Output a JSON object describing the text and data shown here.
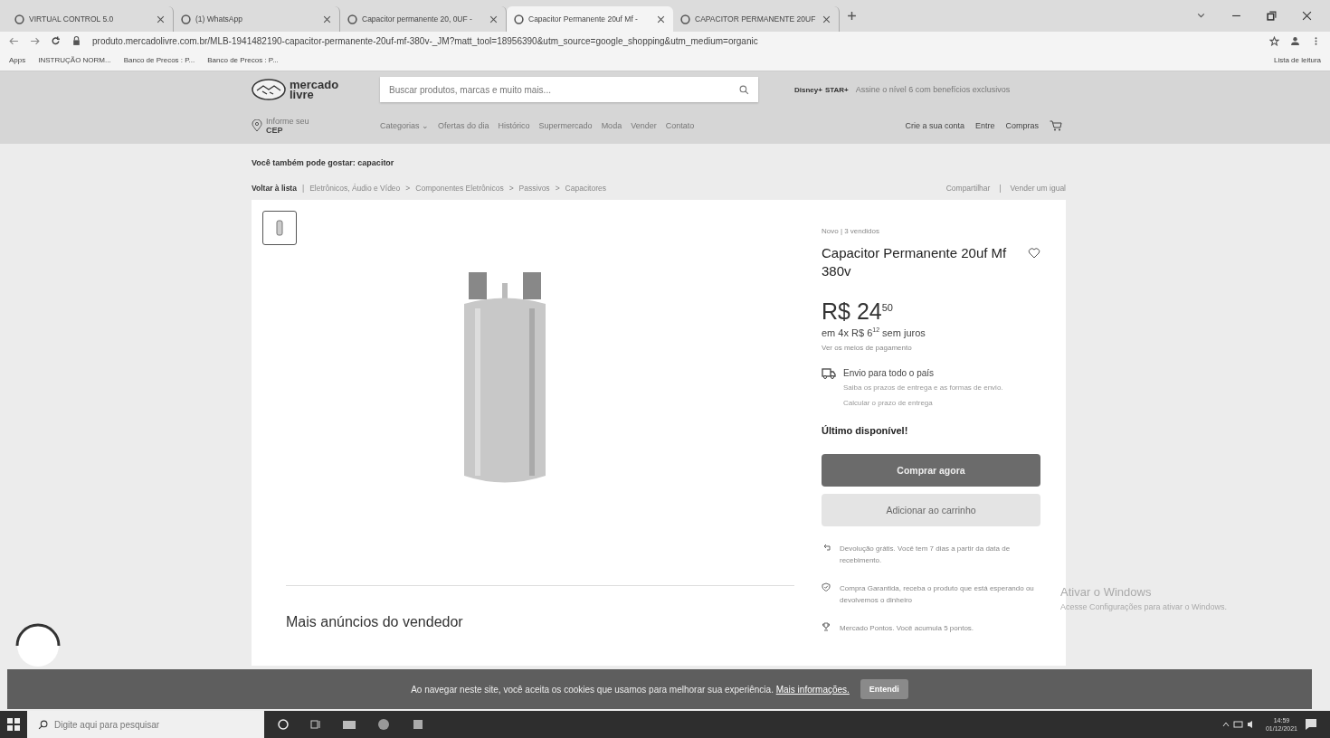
{
  "browser": {
    "tabs": [
      {
        "title": "VIRTUAL CONTROL 5.0",
        "selected": false
      },
      {
        "title": "(1) WhatsApp",
        "selected": false
      },
      {
        "title": "Capacitor permanente 20, 0UF -",
        "selected": false
      },
      {
        "title": "Capacitor Permanente 20uf Mf -",
        "selected": true
      },
      {
        "title": "CAPACITOR PERMANENTE 20UF",
        "selected": false
      }
    ],
    "url": "produto.mercadolivre.com.br/MLB-1941482190-capacitor-permanente-20uf-mf-380v-_JM?matt_tool=18956390&utm_source=google_shopping&utm_medium=organic",
    "bookmarks": [
      "Apps",
      "INSTRUÇÃO NORM...",
      "Banco de Precos : P...",
      "Banco de Precos : P..."
    ],
    "reading_list": "Lista de leitura"
  },
  "header": {
    "logo": [
      "mercado",
      "livre"
    ],
    "search_placeholder": "Buscar produtos, marcas e muito mais...",
    "promo_logo": [
      "Disney+",
      "STAR+"
    ],
    "promo": "Assine o nível 6 com benefícios exclusivos",
    "location": [
      "Informe seu",
      "CEP"
    ],
    "nav": [
      "Categorias ⌄",
      "Ofertas do dia",
      "Histórico",
      "Supermercado",
      "Moda",
      "Vender",
      "Contato"
    ],
    "account": [
      "Crie a sua conta",
      "Entre",
      "Compras"
    ]
  },
  "related": "Você também pode gostar: capacitor",
  "breadcrumb": {
    "back": "Voltar à lista",
    "divider": "|",
    "separator": ">",
    "items": [
      "Eletrônicos, Áudio e Vídeo",
      "Componentes Eletrônicos",
      "Passivos",
      "Capacitores"
    ],
    "actions": [
      "Compartilhar",
      "Vender um igual"
    ]
  },
  "product": {
    "status": "Novo  |  3 vendidos",
    "title": "Capacitor Permanente 20uf Mf 380v",
    "price": "R$ 24$^{50}$",
    "installments": "em 4x R$ 6$^{12}$ sem juros",
    "payment_link": "Ver os meios de pagamento",
    "shipping": {
      "title": "Envio para todo o país",
      "text": "Saiba os prazos de entrega e as formas de envio.",
      "link": "Calcular o prazo de entrega"
    },
    "stock": "Último disponível!",
    "buy": "Comprar agora",
    "cart": "Adicionar ao carrinho",
    "benefits": [
      {
        "kind": "return",
        "text": "Devolução grátis. Você tem 7 dias a partir da data de recebimento."
      },
      {
        "kind": "shield",
        "text": "Compra Garantida, receba o produto que está esperando ou devolvemos o dinheiro"
      },
      {
        "kind": "trophy",
        "text": "Mercado Pontos. Você acumula 5 pontos."
      }
    ],
    "more_title": "Mais anúncios do vendedor"
  },
  "activation": {
    "title": "Ativar o Windows",
    "text": "Acesse Configurações para ativar o Windows."
  },
  "cookie": {
    "text": "Ao navegar neste site, você aceita os cookies que usamos para melhorar sua experiência.",
    "link": "Mais informações.",
    "button": "Entendi"
  },
  "taskbar": {
    "search_placeholder": "Digite aqui para pesquisar",
    "time": "14:59",
    "date": "01/12/2021"
  }
}
